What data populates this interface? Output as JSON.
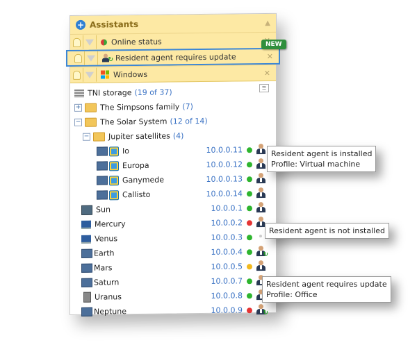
{
  "assistants": {
    "title": "Assistants",
    "rows": [
      {
        "label": "Online status",
        "icon": "online-status-icon"
      },
      {
        "label": "Resident agent requires update",
        "icon": "agent-update-icon",
        "badge": "NEW"
      },
      {
        "label": "Windows",
        "icon": "windows-icon"
      }
    ]
  },
  "tree": {
    "storage": {
      "name": "TNI storage",
      "count": "(19 of 37)"
    },
    "simpsons": {
      "name": "The Simpsons family",
      "count": "(7)"
    },
    "solar": {
      "name": "The Solar System",
      "count": "(12 of 14)"
    },
    "jupiter": {
      "name": "Jupiter satellites",
      "count": "(4)"
    },
    "devices": [
      {
        "name": "Io",
        "ip": "10.0.0.11",
        "status": "green",
        "agent": "installed",
        "type": "vm",
        "level": 3
      },
      {
        "name": "Europa",
        "ip": "10.0.0.12",
        "status": "green",
        "agent": "installed",
        "type": "vm",
        "level": 3
      },
      {
        "name": "Ganymede",
        "ip": "10.0.0.13",
        "status": "green",
        "agent": "installed",
        "type": "vm",
        "level": 3
      },
      {
        "name": "Callisto",
        "ip": "10.0.0.14",
        "status": "green",
        "agent": "installed",
        "type": "vm",
        "level": 3
      },
      {
        "name": "Sun",
        "ip": "10.0.0.1",
        "status": "green",
        "agent": "installed",
        "type": "server",
        "level": 2
      },
      {
        "name": "Mercury",
        "ip": "10.0.0.2",
        "status": "red",
        "agent": "installed",
        "type": "laptop",
        "level": 2
      },
      {
        "name": "Venus",
        "ip": "10.0.0.3",
        "status": "green",
        "agent": "none",
        "type": "laptop",
        "level": 2
      },
      {
        "name": "Earth",
        "ip": "10.0.0.4",
        "status": "green",
        "agent": "update",
        "type": "pc",
        "level": 2
      },
      {
        "name": "Mars",
        "ip": "10.0.0.5",
        "status": "yellow",
        "agent": "installed",
        "type": "pc",
        "level": 2
      },
      {
        "name": "Saturn",
        "ip": "10.0.0.7",
        "status": "green",
        "agent": "update",
        "type": "pc",
        "level": 2
      },
      {
        "name": "Uranus",
        "ip": "10.0.0.8",
        "status": "green",
        "agent": "update",
        "type": "tower",
        "level": 2
      },
      {
        "name": "Neptune",
        "ip": "10.0.0.9",
        "status": "red",
        "agent": "update",
        "type": "pc",
        "level": 2
      }
    ]
  },
  "tooltips": {
    "installed_line1": "Resident agent is installed",
    "installed_line2": "Profile: Virtual machine",
    "not_installed": "Resident agent is not installed",
    "update_line1": "Resident agent requires update",
    "update_line2": "Profile: Office"
  },
  "colors": {
    "green": "#2fb52f",
    "red": "#e53535",
    "yellow": "#f2b91e",
    "accent": "#3b86d6"
  }
}
